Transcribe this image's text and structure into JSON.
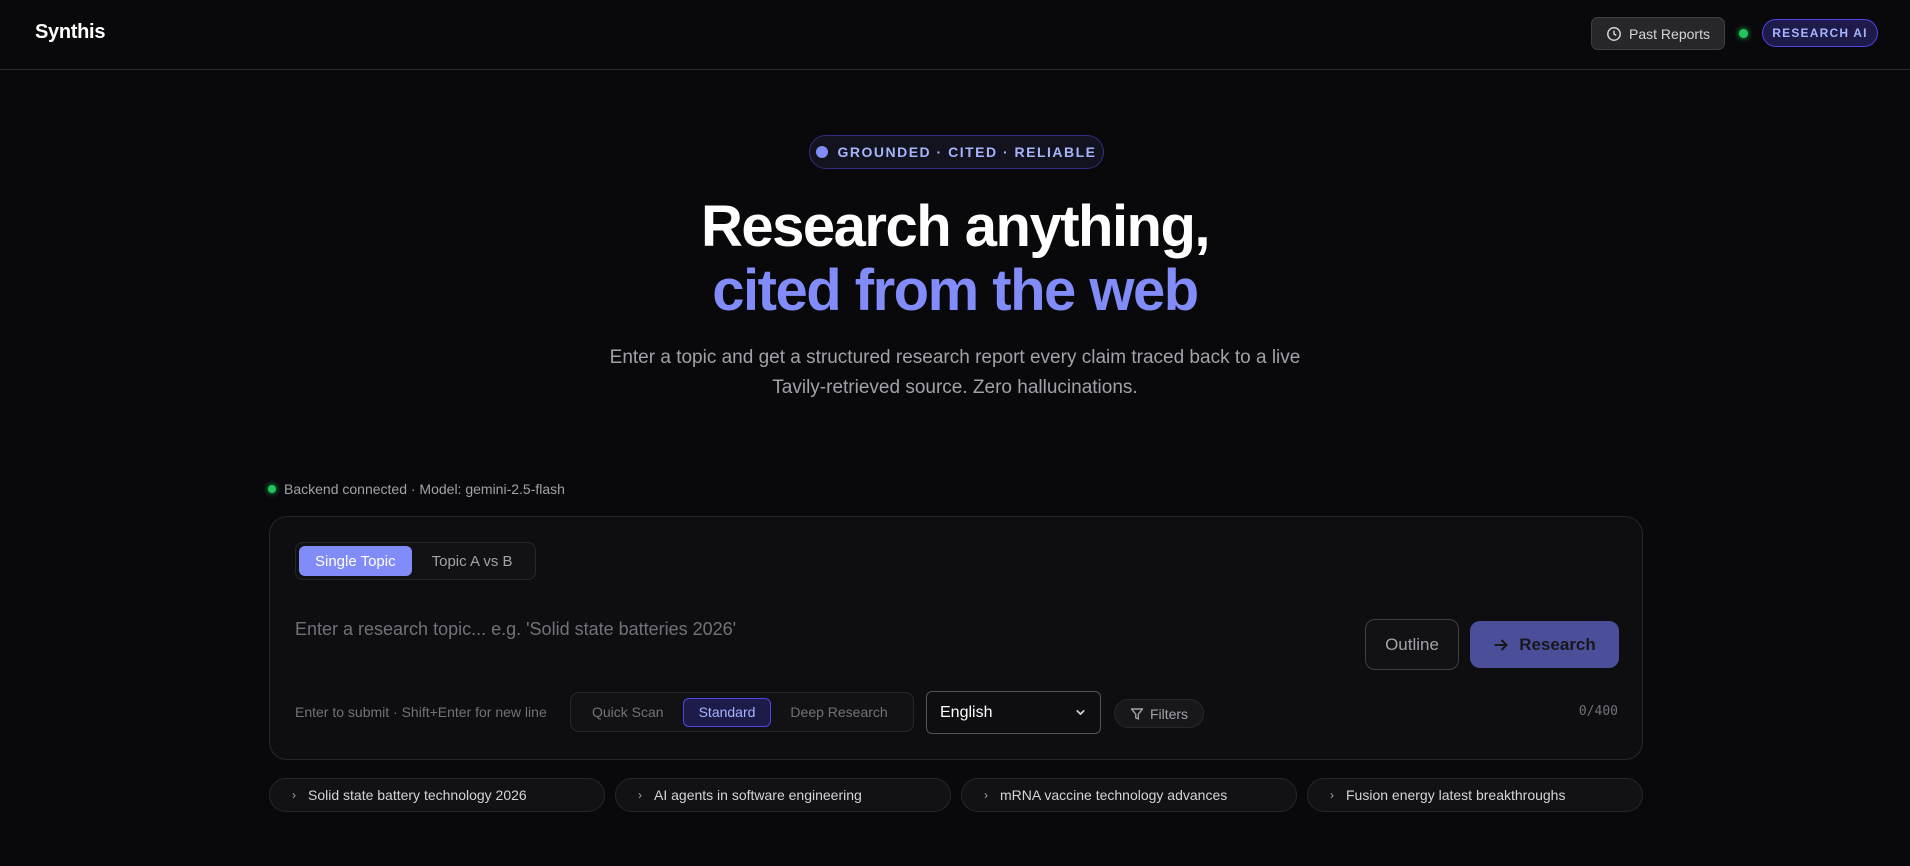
{
  "header": {
    "logo": "Synthis",
    "past_reports_label": "Past Reports",
    "badge": "RESEARCH AI"
  },
  "hero": {
    "pill": "GROUNDED · CITED · RELIABLE",
    "title_line1": "Research anything,",
    "title_line2": "cited from the web",
    "subtitle": "Enter a topic and get a structured research report every claim traced back to a live Tavily-retrieved source. Zero hallucinations."
  },
  "status": {
    "text": "Backend connected · Model: gemini-2.5-flash"
  },
  "form": {
    "modes": [
      "Single Topic",
      "Topic A vs B"
    ],
    "active_mode": "Single Topic",
    "input_value": "",
    "input_placeholder": "Enter a research topic... e.g. 'Solid state batteries 2026'",
    "outline_label": "Outline",
    "research_label": "Research",
    "hint": "Enter to submit · Shift+Enter for new line",
    "depths": [
      "Quick Scan",
      "Standard",
      "Deep Research"
    ],
    "active_depth": "Standard",
    "language": "English",
    "filters_label": "Filters",
    "char_count": "0/400"
  },
  "suggestions": [
    "Solid state battery technology 2026",
    "AI agents in software engineering",
    "mRNA vaccine technology advances",
    "Fusion energy latest breakthroughs"
  ],
  "colors": {
    "accent": "#818cf8",
    "background": "#09090b",
    "status_green": "#22c55e"
  },
  "icons": {
    "past_reports": "clock-icon",
    "research": "arrow-right-icon",
    "language": "chevron-down-icon",
    "filters": "filter-icon",
    "suggestion": "chevron-right-icon"
  }
}
